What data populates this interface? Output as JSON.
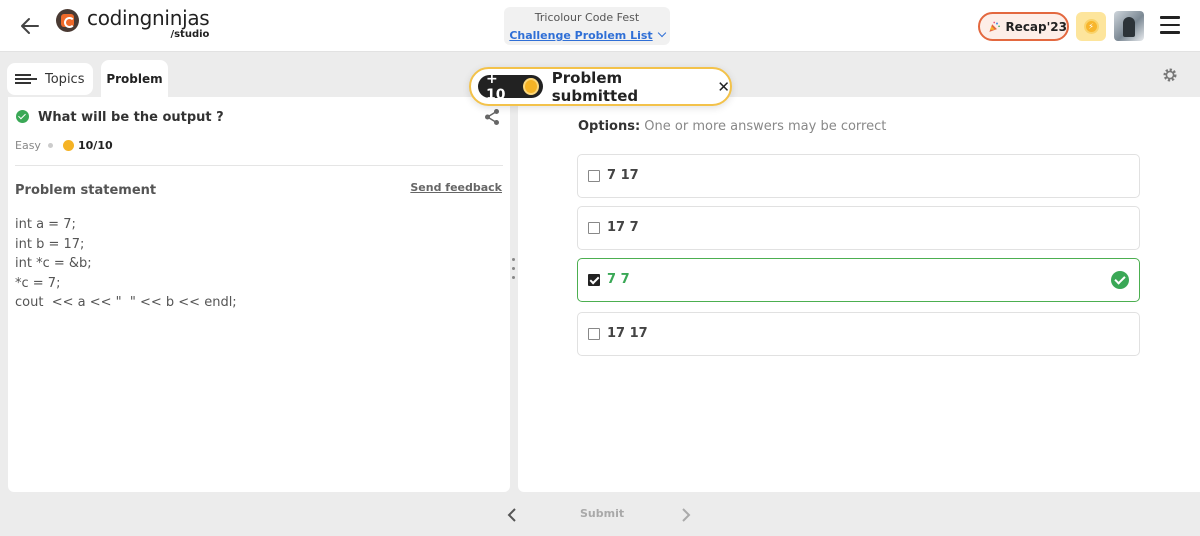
{
  "header": {
    "logo_main": "codingninjas",
    "logo_sub": "/studio",
    "event_title": "Tricolour Code Fest",
    "event_link": "Challenge Problem List",
    "recap_label": "Recap'23"
  },
  "tabs": {
    "topics": "Topics",
    "problem": "Problem"
  },
  "problem": {
    "title": "What will be the output ?",
    "difficulty": "Easy",
    "score": "10/10",
    "statement_label": "Problem statement",
    "feedback_link": "Send feedback",
    "code_lines": [
      "int a = 7;",
      "int b = 17;",
      "int *c = &b;",
      "*c = 7;",
      "cout  << a << \"  \" << b << endl;"
    ]
  },
  "answers": {
    "options_label": "Options:",
    "options_hint": "One or more answers may be correct",
    "options": [
      {
        "label": "7 17",
        "checked": false,
        "correct": false
      },
      {
        "label": "17 7",
        "checked": false,
        "correct": false
      },
      {
        "label": "7 7",
        "checked": true,
        "correct": true
      },
      {
        "label": "17 17",
        "checked": false,
        "correct": false
      }
    ]
  },
  "toast": {
    "points": "+ 10",
    "message": "Problem submitted",
    "close": "✕"
  },
  "footer": {
    "submit": "Submit"
  },
  "colors": {
    "accent_green": "#3aa856",
    "link_blue": "#2f6fd6",
    "recap_border": "#e3683f",
    "toast_border": "#f3c24a"
  }
}
